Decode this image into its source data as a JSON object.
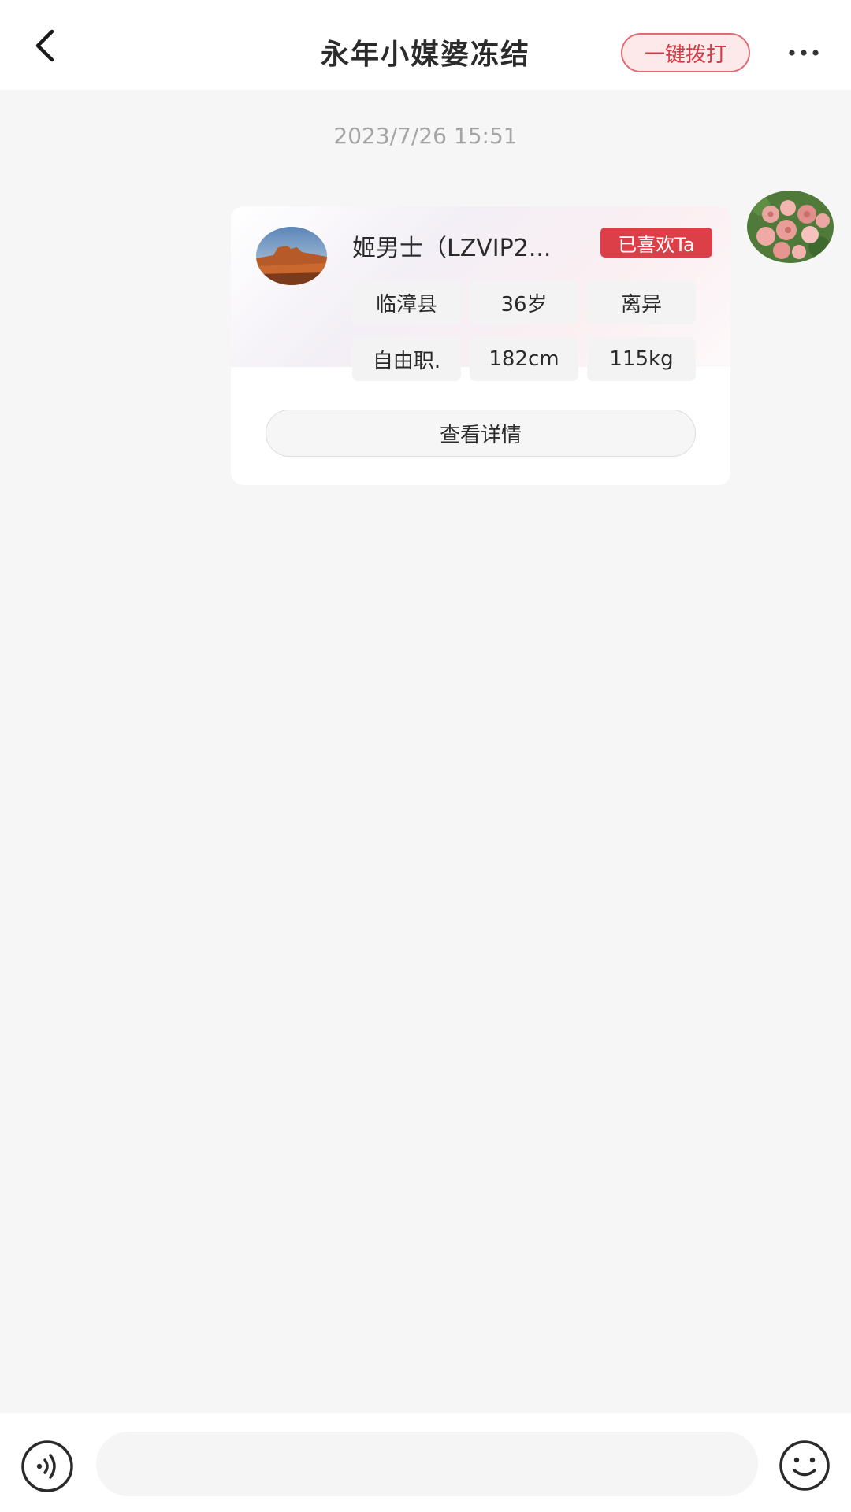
{
  "header": {
    "title": "永年小媒婆冻结",
    "call_button": "一键拨打"
  },
  "chat": {
    "timestamp": "2023/7/26 15:51"
  },
  "profile_card": {
    "name": "姬男士（LZVIP2...",
    "liked_badge": "已喜欢Ta",
    "tags": [
      "临漳县",
      "36岁",
      "离异",
      "自由职.",
      "182cm",
      "115kg"
    ],
    "detail_button": "查看详情"
  },
  "input_bar": {
    "placeholder": ""
  },
  "colors": {
    "accent": "#dc3f47",
    "call_border": "#e06b72",
    "background": "#f6f6f7"
  },
  "icons": {
    "back": "back-arrow-icon",
    "more": "more-dots-icon",
    "voice": "voice-icon",
    "emoji": "emoji-icon"
  }
}
